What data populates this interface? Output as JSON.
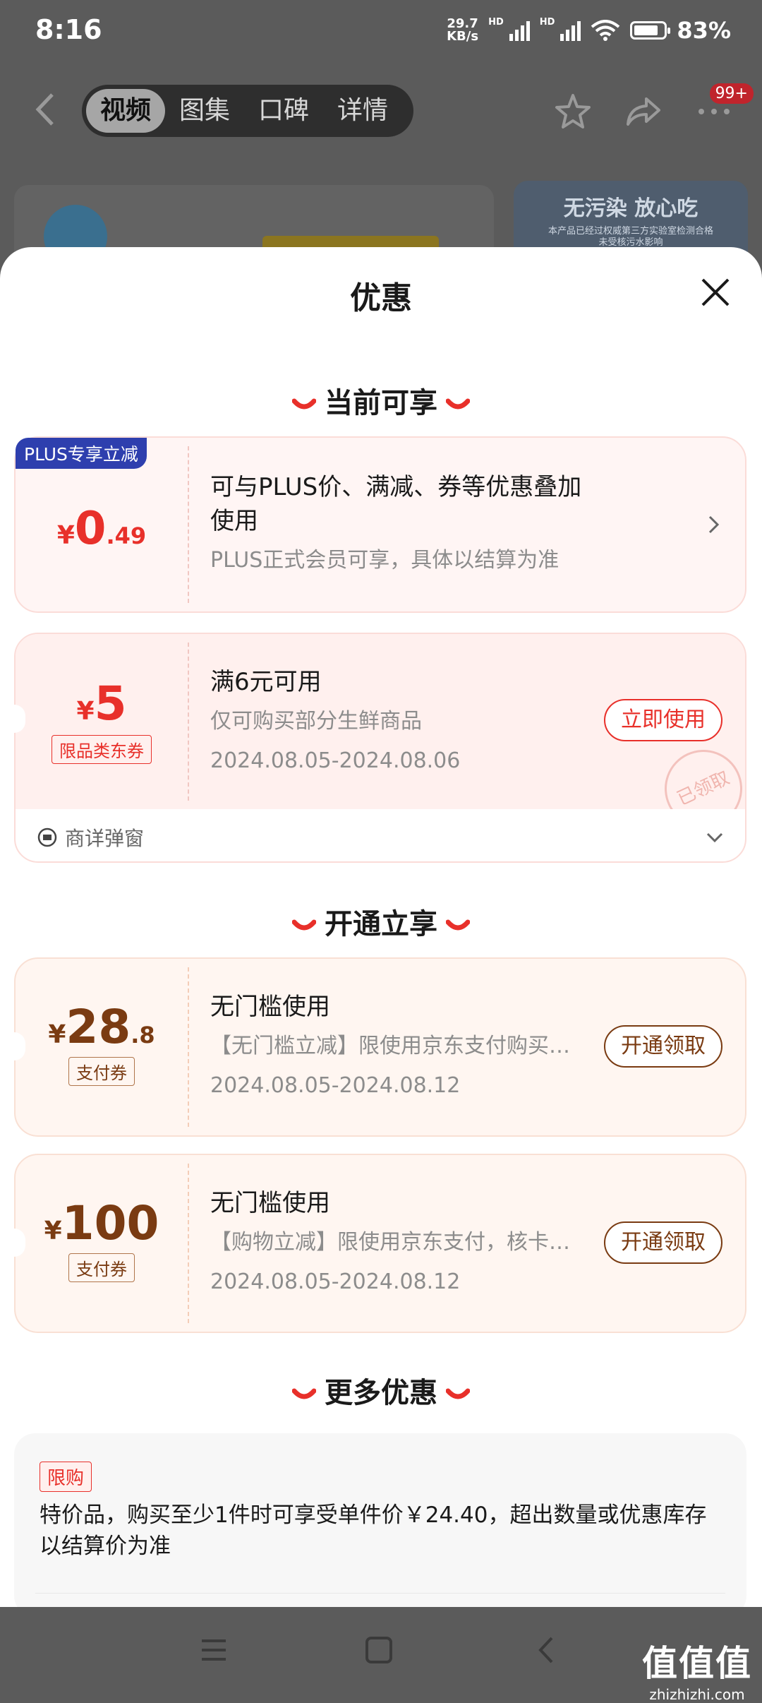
{
  "status_bar": {
    "time": "8:16",
    "net_speed_value": "29.7",
    "net_speed_unit": "KB/s",
    "hd1": "HD",
    "hd2": "HD",
    "wifi_label": "6",
    "battery_percent": "83%",
    "battery_level": 0.83
  },
  "header": {
    "tabs": [
      {
        "label": "视频"
      },
      {
        "label": "图集"
      },
      {
        "label": "口碑"
      },
      {
        "label": "详情"
      }
    ],
    "active_tab": "视频",
    "badge": "99+"
  },
  "background_banner": {
    "title": "无污染 放心吃",
    "subtitle_line1": "本产品已经过权威第三方实验室检测合格",
    "subtitle_line2": "未受核污水影响"
  },
  "sheet": {
    "title": "优惠",
    "sections": [
      {
        "label": "当前可享"
      },
      {
        "label": "开通立享"
      },
      {
        "label": "更多优惠"
      }
    ],
    "plus_coupon": {
      "badge": "PLUS专享立减",
      "currency": "¥",
      "amount_int": "0",
      "amount_dec": ".49",
      "title_line1": "可与PLUS价、满减、券等优惠叠加",
      "title_line2": "使用",
      "sub": "PLUS正式会员可享，具体以结算为准"
    },
    "coupon_5": {
      "currency": "¥",
      "amount": "5",
      "tag": "限品类东券",
      "title": "满6元可用",
      "desc": "仅可购买部分生鲜商品",
      "date": "2024.08.05-2024.08.06",
      "button": "立即使用",
      "stamp": "已领取",
      "footer": "商详弹窗"
    },
    "coupon_28": {
      "currency": "¥",
      "amount_int": "28",
      "amount_dec": ".8",
      "tag": "支付券",
      "title": "无门槛使用",
      "desc": "【无门槛立减】限使用京东支付购买…",
      "date": "2024.08.05-2024.08.12",
      "button": "开通领取"
    },
    "coupon_100": {
      "currency": "¥",
      "amount": "100",
      "tag": "支付券",
      "title": "无门槛使用",
      "desc": "【购物立减】限使用京东支付，核卡…",
      "date": "2024.08.05-2024.08.12",
      "button": "开通领取"
    },
    "more": {
      "tag": "限购",
      "text_line1": "特价品，购买至少1件时可享受单件价￥24.40，超出数量或优惠库存",
      "text_line2": "以结算价为准"
    }
  },
  "watermark": {
    "big": "值值值",
    "small": "zhizhizhi.com"
  },
  "colors": {
    "red": "#e8302a",
    "brown": "#7a3b12",
    "plus_blue": "#2e3fae"
  }
}
